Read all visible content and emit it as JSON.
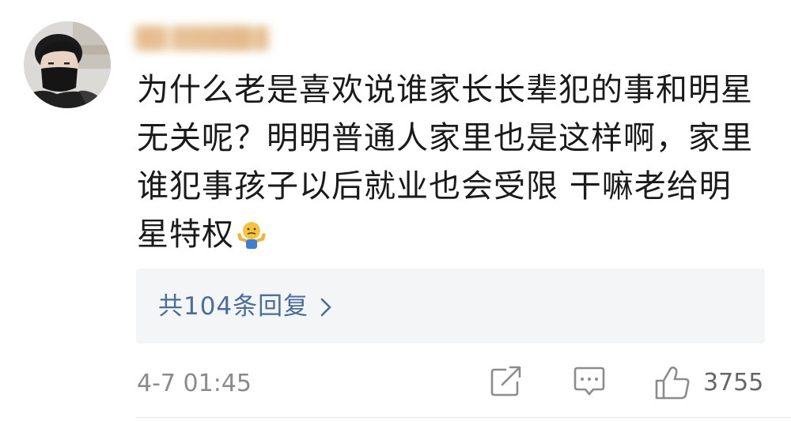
{
  "comment": {
    "username": "██ █████ █",
    "text_lines": [
      "为什么老是喜欢说谁家长长辈犯的事和明星",
      "无关呢？明明普通人家里也是这样啊，家里",
      "谁犯事孩子以后就业也会受限 干嘛老给明",
      "星特权"
    ],
    "emoji": "shrug-emoji"
  },
  "replies": {
    "label": "共104条回复",
    "chevron_icon": "chevron-right-icon"
  },
  "footer": {
    "timestamp": "4-7 01:45",
    "share_icon": "share-icon",
    "comment_icon": "comment-icon",
    "like_icon": "thumbs-up-icon",
    "like_count": "3755"
  },
  "colors": {
    "link": "#4a6d99",
    "text": "#1a1a1a",
    "meta": "#8a8a8a",
    "reply_bg": "#f4f5f7"
  }
}
